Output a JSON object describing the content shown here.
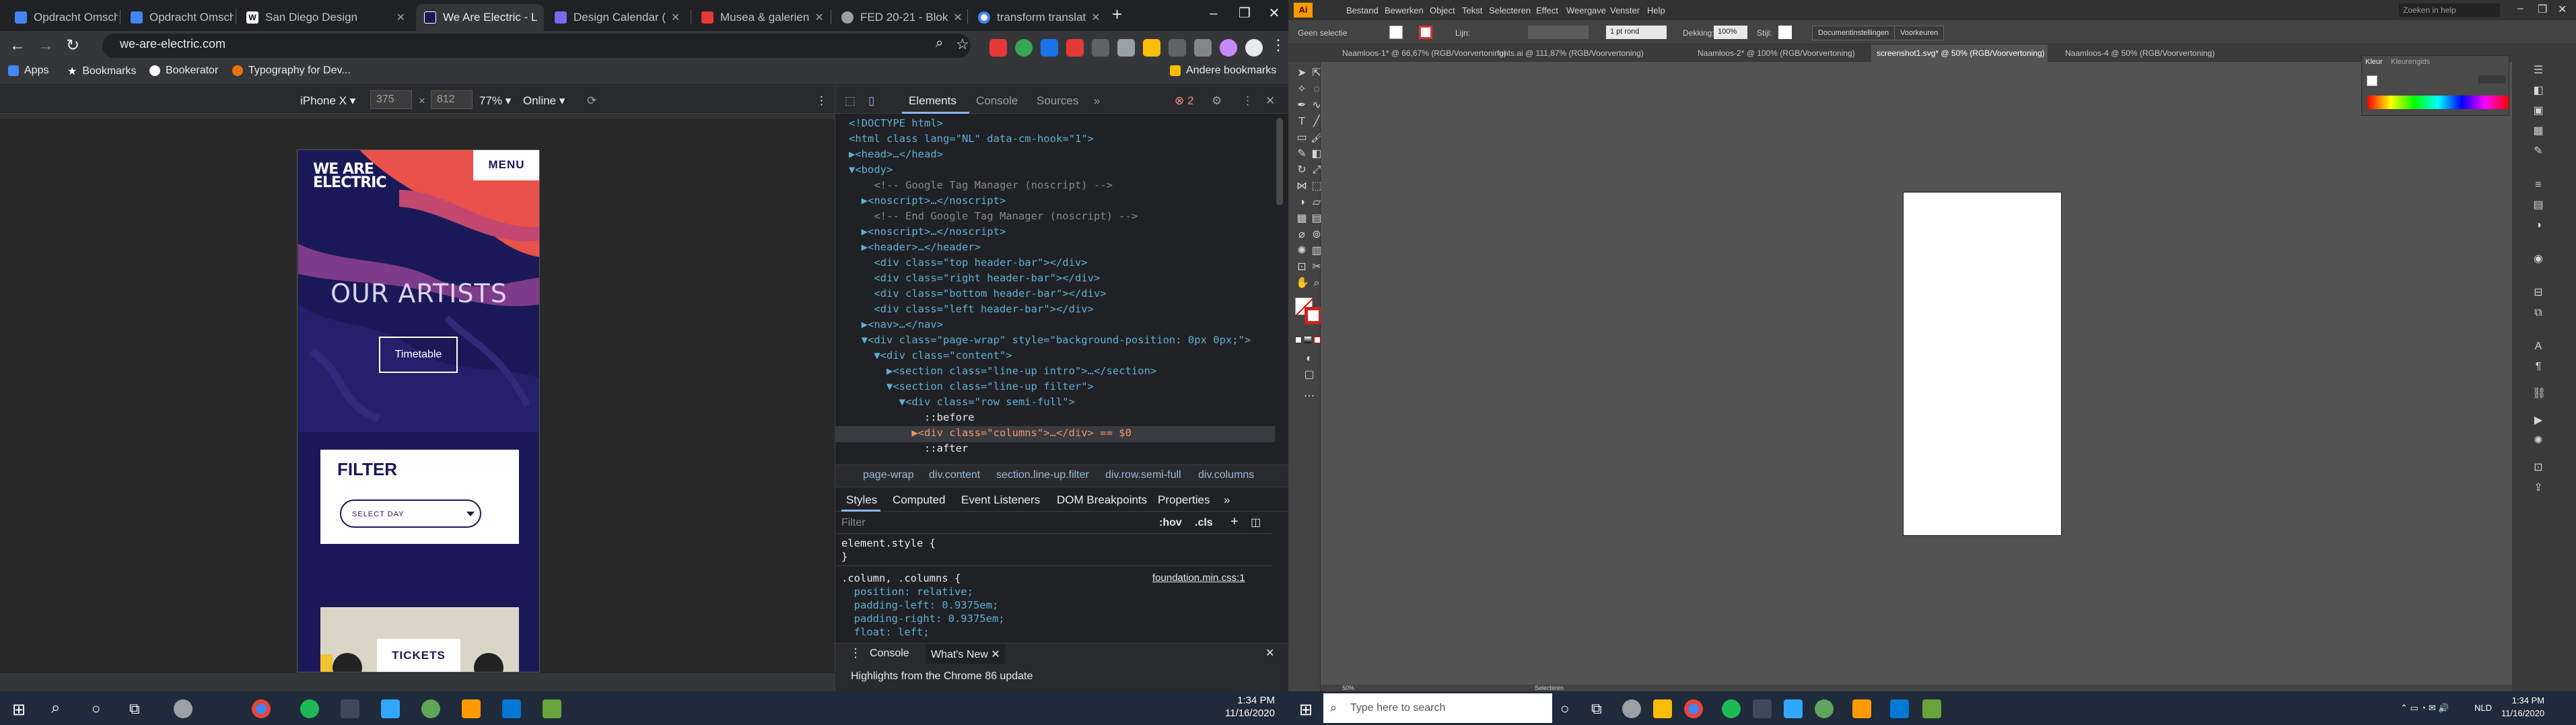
{
  "browser": {
    "tabs": [
      {
        "label": "Opdracht Omsch",
        "favicon_color": "#4285f4"
      },
      {
        "label": "Opdracht Omsch",
        "favicon_color": "#4285f4"
      },
      {
        "label": "San Diego Design",
        "favicon_color": "#ffffff"
      },
      {
        "label": "We Are Electric - L",
        "favicon_color": "#1a1958"
      },
      {
        "label": "Design Calendar (",
        "favicon_color": "#7b68ee"
      },
      {
        "label": "Musea & galerien",
        "favicon_color": "#e53935"
      },
      {
        "label": "FED 20-21 - Blok",
        "favicon_color": "#9aa0a6"
      },
      {
        "label": "transform translat",
        "favicon_color": "#4285f4"
      }
    ],
    "new_tab": "+",
    "url": "we-are-electric.com",
    "bookmarks": [
      "Apps",
      "Bookmarks",
      "Bookerator",
      "Typography for Dev..."
    ],
    "other_bookmarks": "Andere bookmarks"
  },
  "device_toolbar": {
    "device": "iPhone X",
    "width": "375",
    "height": "812",
    "zoom": "77%",
    "network": "Online"
  },
  "site": {
    "logo": "WE ARE\nELECTRIC",
    "menu": "MENU",
    "title": "OUR ARTISTS",
    "timetable": "Timetable",
    "filter_title": "FILTER",
    "select_day": "SELECT DAY",
    "tickets": "TICKETS"
  },
  "devtools": {
    "tabs": [
      "Elements",
      "Console",
      "Sources"
    ],
    "error_count": "2",
    "breadcrumbs": [
      "page-wrap",
      "div.content",
      "section.line-up.filter",
      "div.row.semi-full",
      "div.columns"
    ],
    "subtabs": [
      "Styles",
      "Computed",
      "Event Listeners",
      "DOM Breakpoints",
      "Properties"
    ],
    "filter_placeholder": "Filter",
    "hov": ":hov",
    "cls": ".cls",
    "source_link": "foundation.min.css:1",
    "drawer_tabs": [
      "Console",
      "What's New"
    ],
    "drawer_message": "Highlights from the Chrome 86 update"
  },
  "dom_lines": [
    "<!DOCTYPE html>",
    "<html class lang=\"NL\" data-cm-hook=\"1\">",
    "▶<head>…</head>",
    "▼<body>",
    "    <!-- Google Tag Manager (noscript) -->",
    "  ▶<noscript>…</noscript>",
    "    <!-- End Google Tag Manager (noscript) -->",
    "  ▶<noscript>…</noscript>",
    "  ▶<header>…</header>",
    "    <div class=\"top header-bar\"></div>",
    "    <div class=\"right header-bar\"></div>",
    "    <div class=\"bottom header-bar\"></div>",
    "    <div class=\"left header-bar\"></div>",
    "  ▶<nav>…</nav>",
    "  ▼<div class=\"page-wrap\" style=\"background-position: 0px 0px;\">",
    "    ▼<div class=\"content\">",
    "      ▶<section class=\"line-up intro\">…</section>",
    "      ▼<section class=\"line-up filter\">",
    "        ▼<div class=\"row semi-full\">",
    "            ::before",
    "          ▶<div class=\"columns\">…</div> == $0",
    "            ::after"
  ],
  "styles": [
    "element.style {",
    "}",
    ".column, .columns {",
    "  position: relative;",
    "  padding-left: 0.9375em;",
    "  padding-right: 0.9375em;",
    "  float: left;"
  ],
  "illustrator": {
    "menus": [
      "Bestand",
      "Bewerken",
      "Object",
      "Tekst",
      "Selecteren",
      "Effect",
      "Weergave",
      "Venster",
      "Help"
    ],
    "search_placeholder": "Zoeken in help",
    "ctrl_label": "Geen selectie",
    "stroke_label": "Lijn:",
    "stroke_value": "1 pt rond",
    "opacity_label": "Dekking:",
    "opacity_value": "100%",
    "style_label": "Stijl:",
    "doc_settings": "Documentinstellingen",
    "prefs": "Voorkeuren",
    "doc_tabs": [
      "Naamloos-1* @ 66,67% (RGB/Voorvertoning)",
      "fonts.ai @ 111,87% (RGB/Voorvertoning)",
      "Naamloos-2* @ 100% (RGB/Voorvertoning)",
      "screenshot1.svg* @ 50% (RGB/Voorvertoning)",
      "Naamloos-4 @ 50% (RGB/Voorvertoning)"
    ],
    "panel_tabs": [
      "Kleur",
      "Kleurengids"
    ],
    "zoom": "50%",
    "status": "Selecteren"
  },
  "taskbar": {
    "search_placeholder": "Type here to search",
    "time_left": "1:34 PM",
    "date_left": "11/16/2020",
    "time_right": "1:34 PM",
    "date_right": "11/16/2020",
    "lang": "NLD"
  }
}
